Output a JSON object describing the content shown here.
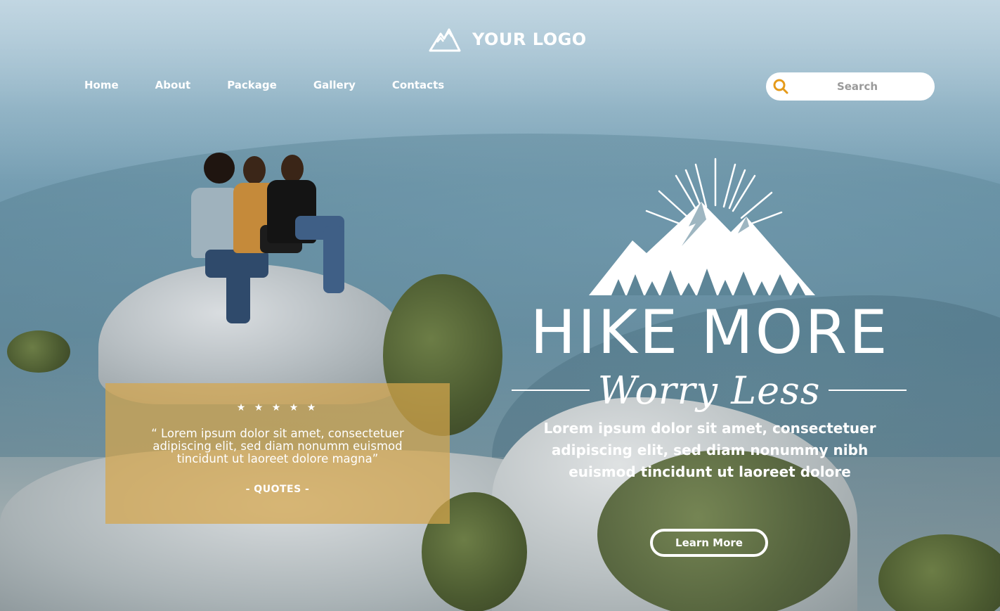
{
  "header": {
    "logo_text": "YOUR LOGO",
    "logo_icon": "mountain-icon"
  },
  "nav": {
    "items": [
      {
        "label": "Home"
      },
      {
        "label": "About"
      },
      {
        "label": "Package"
      },
      {
        "label": "Gallery"
      },
      {
        "label": "Contacts"
      }
    ]
  },
  "search": {
    "placeholder": "Search",
    "icon": "search-icon",
    "icon_color": "#e59a1a"
  },
  "hero": {
    "title": "HIKE MORE",
    "subtitle": "Worry Less",
    "description": "Lorem ipsum dolor sit amet, consectetuer adipiscing elit, sed diam nonummy nibh euismod tincidunt ut laoreet dolore",
    "button_label": "Learn More",
    "emblem": "mountain-sunburst-icon"
  },
  "quote": {
    "stars": "★ ★ ★ ★ ★",
    "rating": 5,
    "text": "“ Lorem ipsum dolor sit amet, consectetuer adipiscing elit, sed diam nonumm euismod tincidunt ut laoreet dolore magna”",
    "label": "- QUOTES -",
    "box_color": "#d6a64c"
  },
  "colors": {
    "accent": "#e59a1a",
    "text": "#ffffff"
  }
}
